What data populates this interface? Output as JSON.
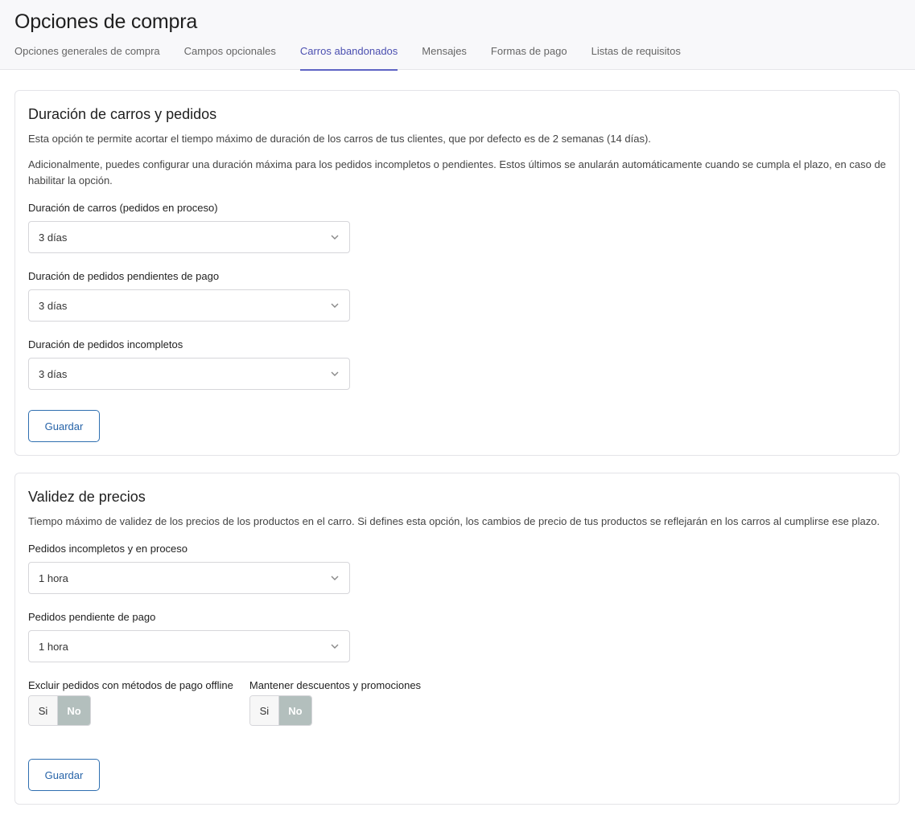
{
  "header": {
    "title": "Opciones de compra",
    "tabs": [
      {
        "label": "Opciones generales de compra"
      },
      {
        "label": "Campos opcionales"
      },
      {
        "label": "Carros abandonados"
      },
      {
        "label": "Mensajes"
      },
      {
        "label": "Formas de pago"
      },
      {
        "label": "Listas de requisitos"
      }
    ],
    "active_tab": "Carros abandonados"
  },
  "duracion": {
    "title": "Duración de carros y pedidos",
    "desc1": "Esta opción te permite acortar el tiempo máximo de duración de los carros de tus clientes, que por defecto es de 2 semanas (14 días).",
    "desc2": "Adicionalmente, puedes configurar una duración máxima para los pedidos incompletos o pendientes. Estos últimos se anularán automáticamente cuando se cumpla el plazo, en caso de habilitar la opción.",
    "fields": [
      {
        "label": "Duración de carros (pedidos en proceso)",
        "value": "3 días"
      },
      {
        "label": "Duración de pedidos pendientes de pago",
        "value": "3 días"
      },
      {
        "label": "Duración de pedidos incompletos",
        "value": "3 días"
      }
    ],
    "save_label": "Guardar"
  },
  "validez": {
    "title": "Validez de precios",
    "desc": "Tiempo máximo de validez de los precios de los productos en el carro. Si defines esta opción, los cambios de precio de tus productos se reflejarán en los carros al cumplirse ese plazo.",
    "fields": [
      {
        "label": "Pedidos incompletos y en proceso",
        "value": "1 hora"
      },
      {
        "label": "Pedidos pendiente de pago",
        "value": "1 hora"
      }
    ],
    "toggles": [
      {
        "label": "Excluir pedidos con métodos de pago offline",
        "yes": "Si",
        "no": "No",
        "selected": "No"
      },
      {
        "label": "Mantener descuentos y promociones",
        "yes": "Si",
        "no": "No",
        "selected": "No"
      }
    ],
    "save_label": "Guardar"
  },
  "colors": {
    "accent": "#5e63c4",
    "button": "#2663a8",
    "toggle_selected": "#b3bfbd"
  },
  "icons": {
    "select_chevron": "chevron-down-icon"
  }
}
